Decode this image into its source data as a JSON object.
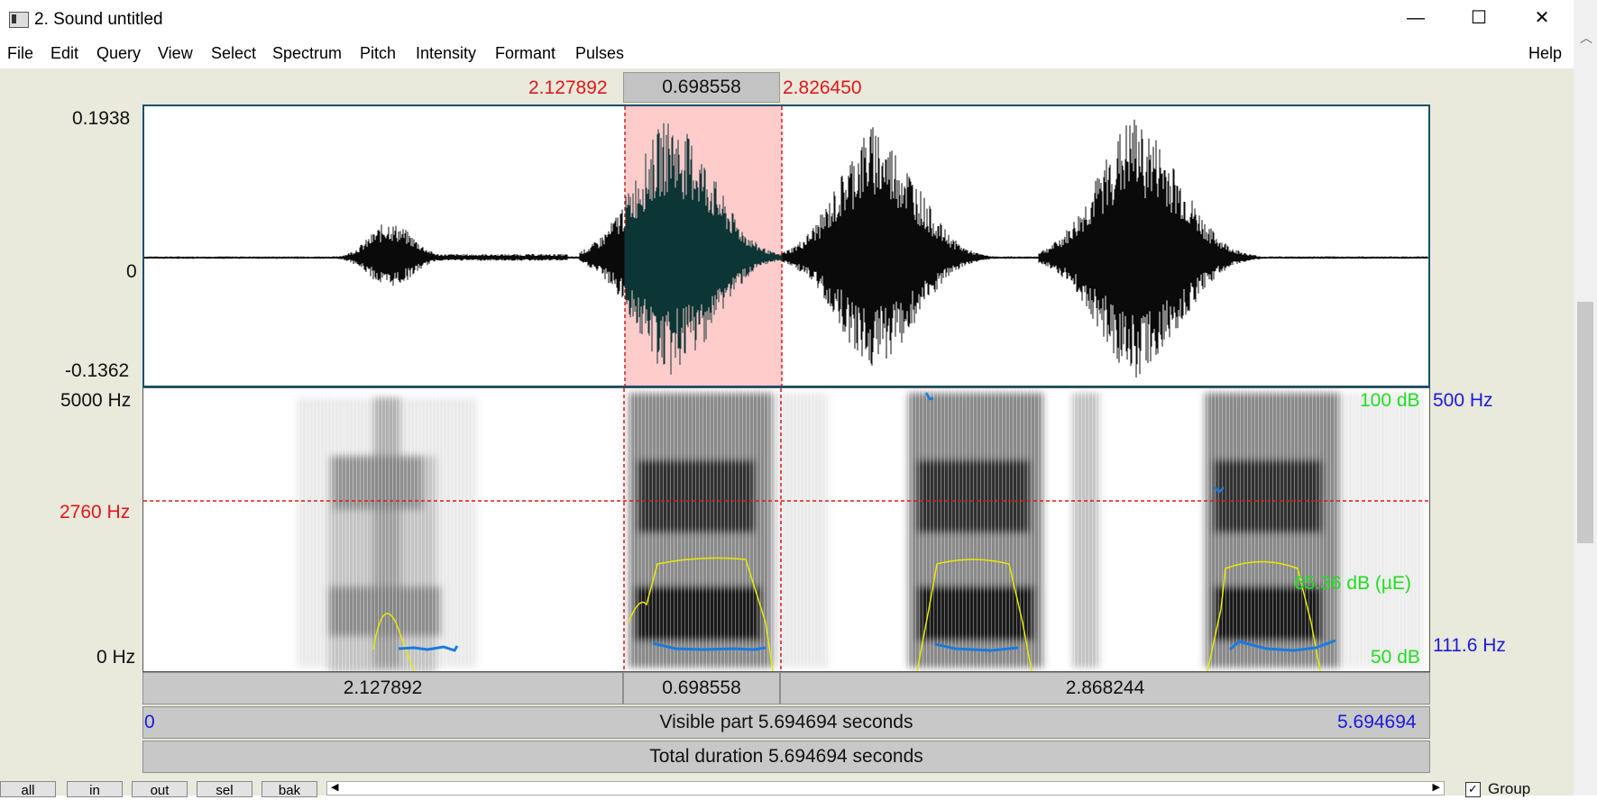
{
  "window": {
    "title": "2. Sound untitled"
  },
  "window_controls": {
    "minimize": "—",
    "maximize": "☐",
    "close": "✕"
  },
  "menu": [
    "File",
    "Edit",
    "Query",
    "View",
    "Select",
    "Spectrum",
    "Pitch",
    "Intensity",
    "Formant",
    "Pulses"
  ],
  "help_label": "Help",
  "selection": {
    "start": "2.127892",
    "duration": "0.698558",
    "end": "2.826450"
  },
  "waveform": {
    "y_max": "0.1938",
    "y_zero": "0",
    "y_min": "-0.1362"
  },
  "spectrogram": {
    "freq_top": "5000 Hz",
    "freq_cursor": "2760 Hz",
    "freq_bottom": "0 Hz",
    "intensity_top": "100 dB",
    "intensity_value": "65.36 dB (µE)",
    "intensity_bottom": "50 dB",
    "pitch_top": "500 Hz",
    "pitch_value": "111.6 Hz"
  },
  "segments": {
    "left": "2.127892",
    "middle": "0.698558",
    "right": "2.868244"
  },
  "visible": {
    "start": "0",
    "label": "Visible part 5.694694 seconds",
    "end": "5.694694"
  },
  "total": {
    "label": "Total duration 5.694694 seconds"
  },
  "zoom_buttons": [
    "all",
    "in",
    "out",
    "sel",
    "bak"
  ],
  "group_label": "Group",
  "colors": {
    "selection": "#ffcccc",
    "cursor": "#e01818",
    "pitch": "#1a7ae0",
    "intensity": "#e0e020"
  }
}
